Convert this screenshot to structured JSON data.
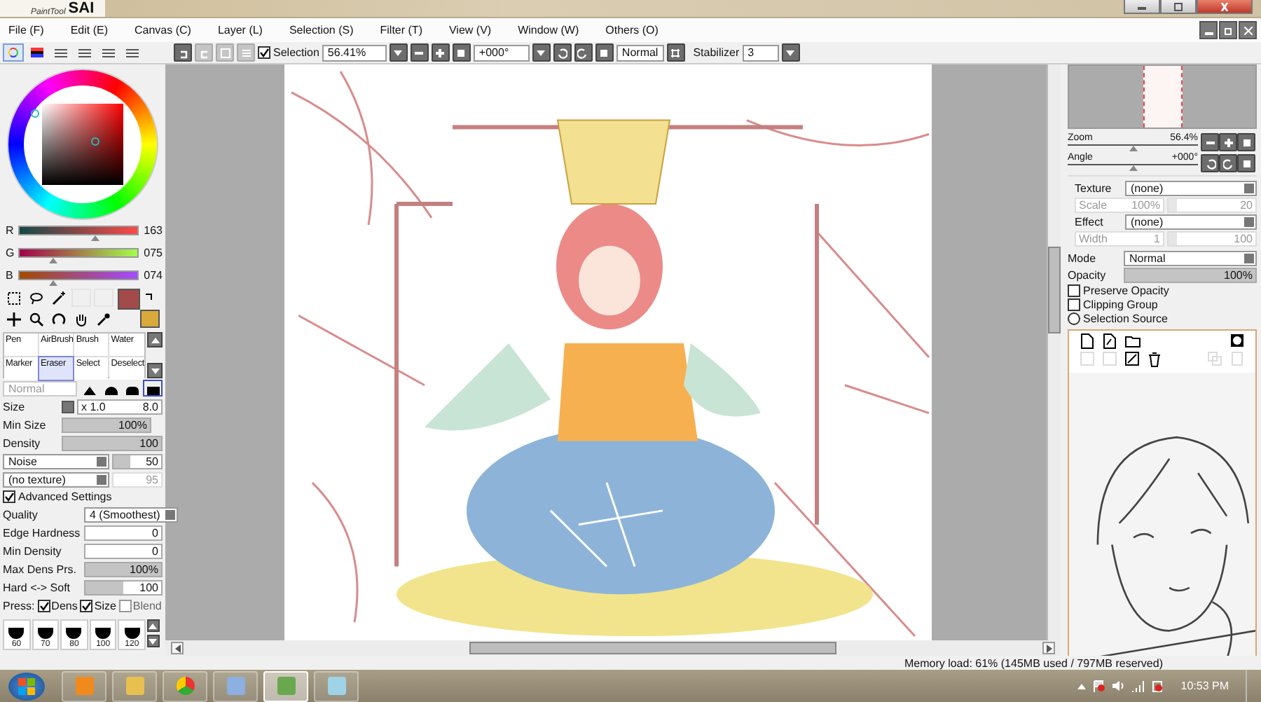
{
  "title_bar": {
    "logo_small": "PaintTool",
    "logo": "SAI"
  },
  "menu": [
    "File (F)",
    "Edit (E)",
    "Canvas (C)",
    "Layer (L)",
    "Selection (S)",
    "Filter (T)",
    "View (V)",
    "Window (W)",
    "Others (O)"
  ],
  "toolbar": {
    "selection": {
      "label": "Selection",
      "checked": true
    },
    "zoom": "56.41%",
    "angle": "+000°",
    "blend_mode": "Normal",
    "stabilizer": {
      "label": "Stabilizer",
      "value": "3"
    }
  },
  "color_tabs": [
    {
      "selected": true
    },
    {
      "selected": false
    },
    {
      "selected": false
    },
    {
      "selected": false
    },
    {
      "selected": false
    },
    {
      "selected": false
    }
  ],
  "color_sliders": [
    {
      "label": "R",
      "value": "163",
      "level": 0.64
    },
    {
      "label": "G",
      "value": "075",
      "level": 0.29
    },
    {
      "label": "B",
      "value": "074",
      "level": 0.29
    }
  ],
  "tools": [
    {
      "label": "Pen",
      "selected": false
    },
    {
      "label": "AirBrush",
      "selected": false
    },
    {
      "label": "Brush",
      "selected": false
    },
    {
      "label": "Water",
      "selected": false
    },
    {
      "label": "Marker",
      "selected": false
    },
    {
      "label": "Eraser",
      "selected": true
    },
    {
      "label": "Select",
      "selected": false
    },
    {
      "label": "Deselect",
      "selected": false
    }
  ],
  "brush": {
    "mode": "Normal",
    "shapes": [
      {
        "selected": false
      },
      {
        "selected": false
      },
      {
        "selected": false
      },
      {
        "selected": true
      }
    ],
    "size": {
      "label": "Size",
      "multiplier": "x 1.0",
      "value": "8.0"
    },
    "min_size": {
      "label": "Min Size",
      "value": "100%",
      "level": 1
    },
    "density": {
      "label": "Density",
      "value": "100",
      "level": 1
    },
    "noise": {
      "type": "Noise",
      "value": "50",
      "level": 0.35
    },
    "texture": {
      "type": "(no texture)",
      "value": "95"
    },
    "advanced": {
      "label": "Advanced Settings",
      "checked": true
    },
    "quality": {
      "label": "Quality",
      "value": "4 (Smoothest)"
    },
    "advanced_rows": [
      {
        "label": "Edge Hardness",
        "value": "0"
      },
      {
        "label": "Min Density",
        "value": "0"
      },
      {
        "label": "Max Dens Prs.",
        "value": "100%",
        "level": 1
      },
      {
        "label": "Hard <-> Soft",
        "value": "100",
        "level": 0.5
      }
    ],
    "pressure": {
      "label": "Press:",
      "options": [
        {
          "label": "Dens",
          "checked": true
        },
        {
          "label": "Size",
          "checked": true
        },
        {
          "label": "Blend",
          "checked": false
        }
      ]
    },
    "sizes": [
      "60",
      "70",
      "80",
      "100",
      "120"
    ]
  },
  "navigator": {
    "zoom": {
      "label": "Zoom",
      "value": "56.4%",
      "level": 0.5
    },
    "angle": {
      "label": "Angle",
      "value": "+000°",
      "level": 0.5
    }
  },
  "texture": {
    "label": "Texture",
    "value": "(none)",
    "scale": {
      "label": "Scale",
      "value": "100%"
    },
    "amount": {
      "value": "20",
      "level": 0.1
    }
  },
  "effect": {
    "label": "Effect",
    "value": "(none)",
    "width": {
      "label": "Width",
      "value": "1"
    },
    "amount": {
      "value": "100",
      "level": 0.1
    }
  },
  "layer": {
    "mode_label": "Mode",
    "mode": "Normal",
    "opacity": {
      "label": "Opacity",
      "value": "100%",
      "level": 1
    },
    "options": [
      {
        "kind": "checkbox",
        "label": "Preserve Opacity",
        "checked": false
      },
      {
        "kind": "checkbox",
        "label": "Clipping Group",
        "checked": false
      },
      {
        "kind": "radio",
        "label": "Selection Source",
        "checked": false
      }
    ]
  },
  "status_bar": {
    "memory": "Memory load: 61% (145MB used / 797MB reserved)"
  },
  "taskbar": {
    "apps": [
      {
        "selected": false
      },
      {
        "selected": false
      },
      {
        "selected": false
      },
      {
        "selected": false
      },
      {
        "selected": true
      },
      {
        "selected": false
      }
    ],
    "clock": "10:53 PM"
  }
}
